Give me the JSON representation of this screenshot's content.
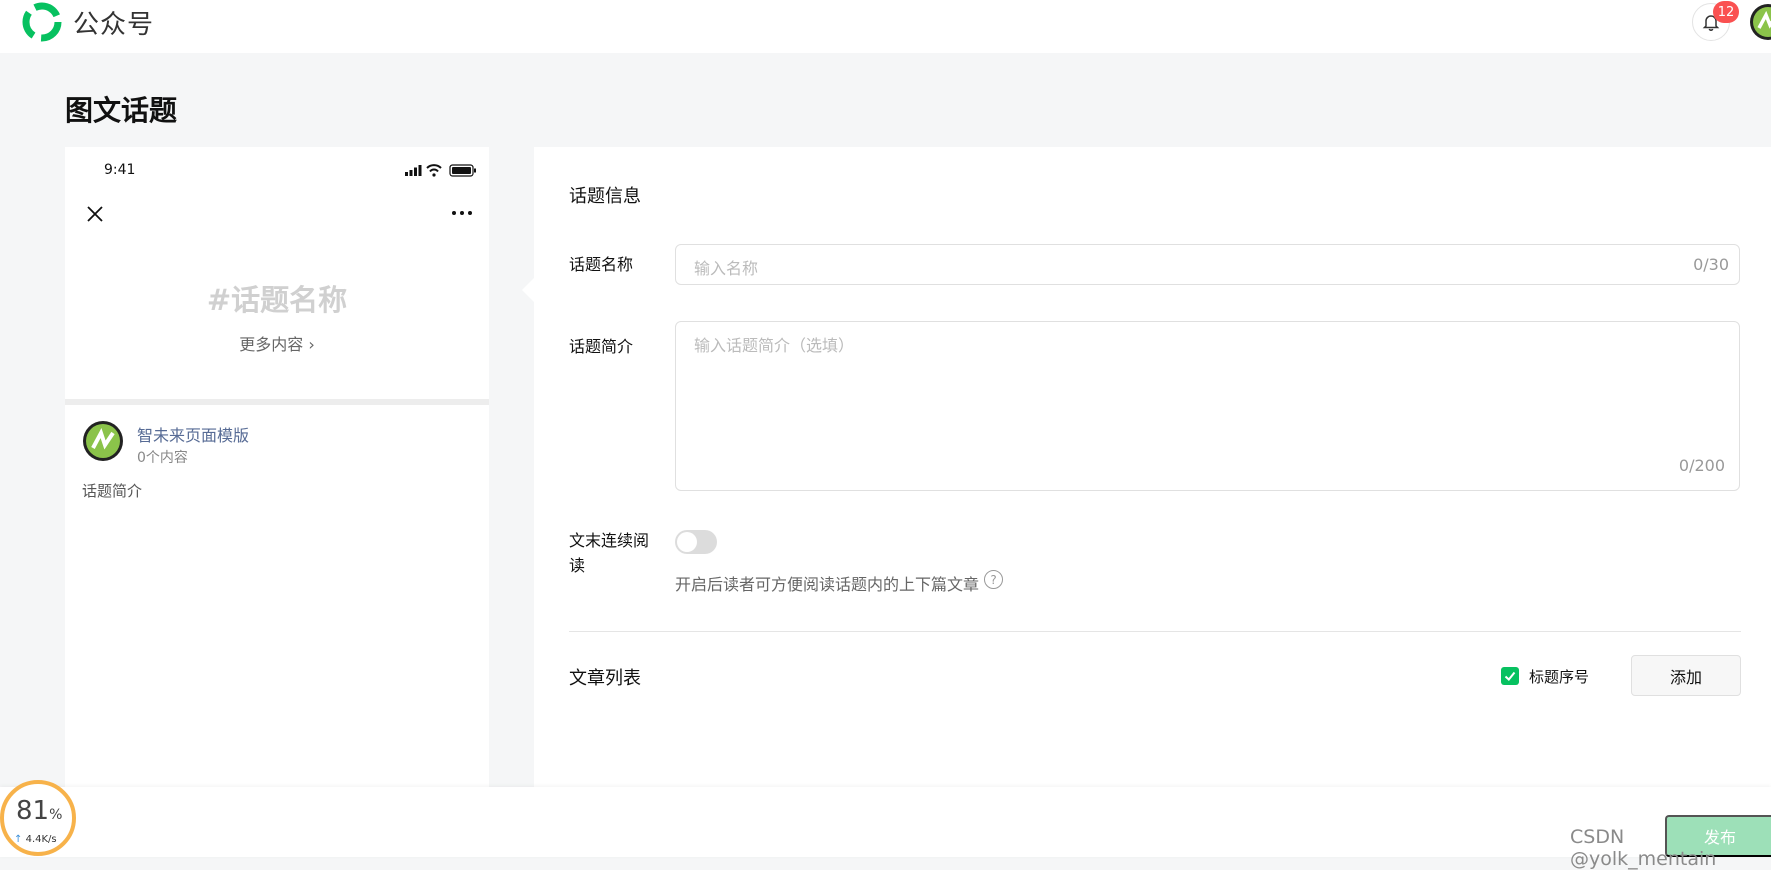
{
  "header": {
    "brand": "公众号",
    "notification_count": "12"
  },
  "page": {
    "title": "图文话题"
  },
  "preview": {
    "time": "9:41",
    "topic_placeholder": "#话题名称",
    "more_content": "更多内容 ›",
    "account_name": "智未来页面模版",
    "content_count": "0个内容",
    "intro": "话题简介"
  },
  "form": {
    "section_title": "话题信息",
    "name_label": "话题名称",
    "name_placeholder": "输入名称",
    "name_counter": "0/30",
    "intro_label": "话题简介",
    "intro_placeholder": "输入话题简介（选填）",
    "intro_counter": "0/200",
    "continuous_label": "文末连续阅读",
    "continuous_hint": "开启后读者可方便阅读话题内的上下篇文章",
    "help_symbol": "?"
  },
  "articles": {
    "section_title": "文章列表",
    "checkbox_label": "标题序号",
    "add_label": "添加"
  },
  "footer": {
    "publish_label": "发布",
    "watermark": "CSDN @yolk_mentain"
  },
  "speed_widget": {
    "percent": "81",
    "percent_unit": "%",
    "rate": "4.4K/s"
  },
  "colors": {
    "brand_green": "#07c160",
    "badge_red": "#fa5151",
    "link_blue": "#576b95"
  },
  "icons": [
    "logo-icon",
    "bell-icon",
    "close-icon",
    "more-icon",
    "signal-icon",
    "wifi-icon",
    "battery-icon",
    "help-icon",
    "check-icon",
    "upload-arrow-icon"
  ]
}
